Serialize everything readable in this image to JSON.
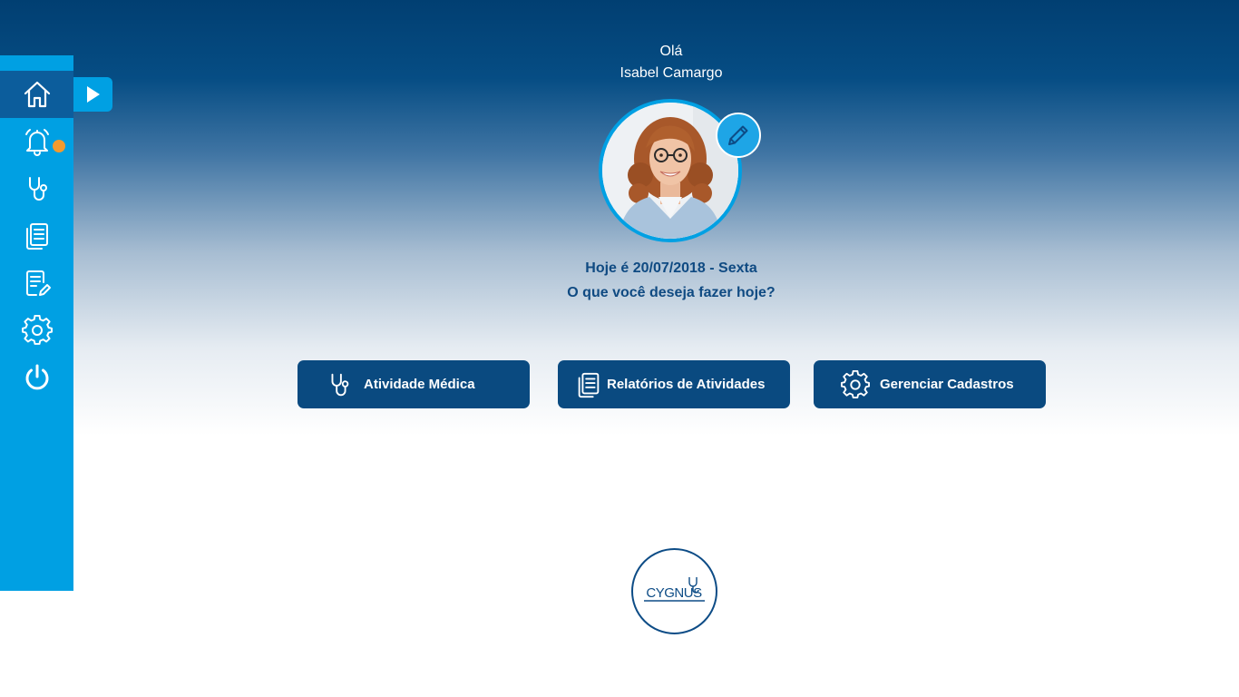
{
  "greeting": {
    "hello": "Olá",
    "name": "Isabel Camargo"
  },
  "date_text": "Hoje é 20/07/2018 - Sexta",
  "question_text": "O que você deseja fazer hoje?",
  "sidebar": {
    "items": [
      {
        "icon": "home-icon",
        "active": true
      },
      {
        "icon": "bell-icon",
        "has_notification": true
      },
      {
        "icon": "stethoscope-icon"
      },
      {
        "icon": "documents-icon"
      },
      {
        "icon": "edit-document-icon"
      },
      {
        "icon": "gear-icon"
      },
      {
        "icon": "power-icon"
      }
    ]
  },
  "actions": [
    {
      "label": "Atividade Médica",
      "icon": "stethoscope-icon"
    },
    {
      "label": "Relatórios de Atividades",
      "icon": "documents-icon"
    },
    {
      "label": "Gerenciar Cadastros",
      "icon": "gear-icon"
    }
  ],
  "logo": {
    "text": "CYGNUS"
  },
  "colors": {
    "sidebar": "#00a0e3",
    "sidebar_active": "#0c5d9c",
    "primary_button": "#0a4a80",
    "notification_dot": "#f39a2e",
    "heading_text": "#0f4a82"
  }
}
